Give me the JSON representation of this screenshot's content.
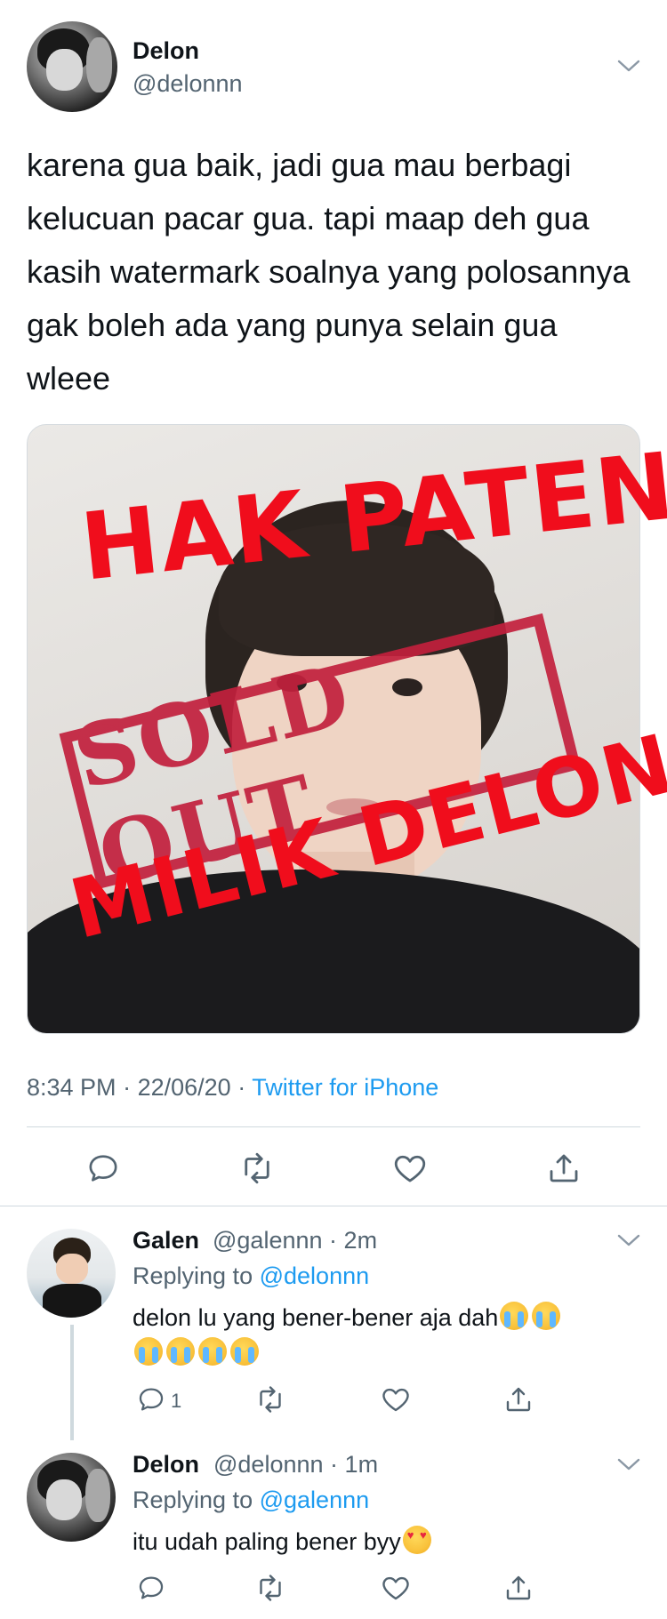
{
  "tweet": {
    "author_name": "Delon",
    "author_handle": "@delonnn",
    "text": "karena gua baik, jadi gua mau berbagi kelucuan pacar gua. tapi maap deh gua kasih watermark soalnya yang polosannya gak boleh ada yang punya selain gua wleee",
    "time": "8:34 PM",
    "date": "22/06/20",
    "separator": "·",
    "source": "Twitter for iPhone",
    "photo_overlay": {
      "top_text": "HAK PATEN",
      "stamp_text": "SOLD OUT",
      "bottom_text": "MILIK DELON"
    }
  },
  "replies": [
    {
      "author_name": "Galen",
      "author_handle": "@galennn",
      "time_ago": "2m",
      "replying_label": "Replying to",
      "replying_to": "@delonnn",
      "text_line1": "delon lu yang bener-bener aja dah",
      "reply_count": "1"
    },
    {
      "author_name": "Delon",
      "author_handle": "@delonnn",
      "time_ago": "1m",
      "replying_label": "Replying to",
      "replying_to": "@galennn",
      "text": "itu udah paling bener byy"
    }
  ],
  "icons": {
    "reply": "reply-icon",
    "retweet": "retweet-icon",
    "like": "heart-icon",
    "share": "share-icon",
    "more": "chevron-down-icon"
  },
  "colors": {
    "link": "#1d9bf0",
    "secondary_text": "#536471",
    "primary_text": "#0f1419",
    "watermark_red": "#f00d1c",
    "stamp_red": "#c2203d"
  }
}
